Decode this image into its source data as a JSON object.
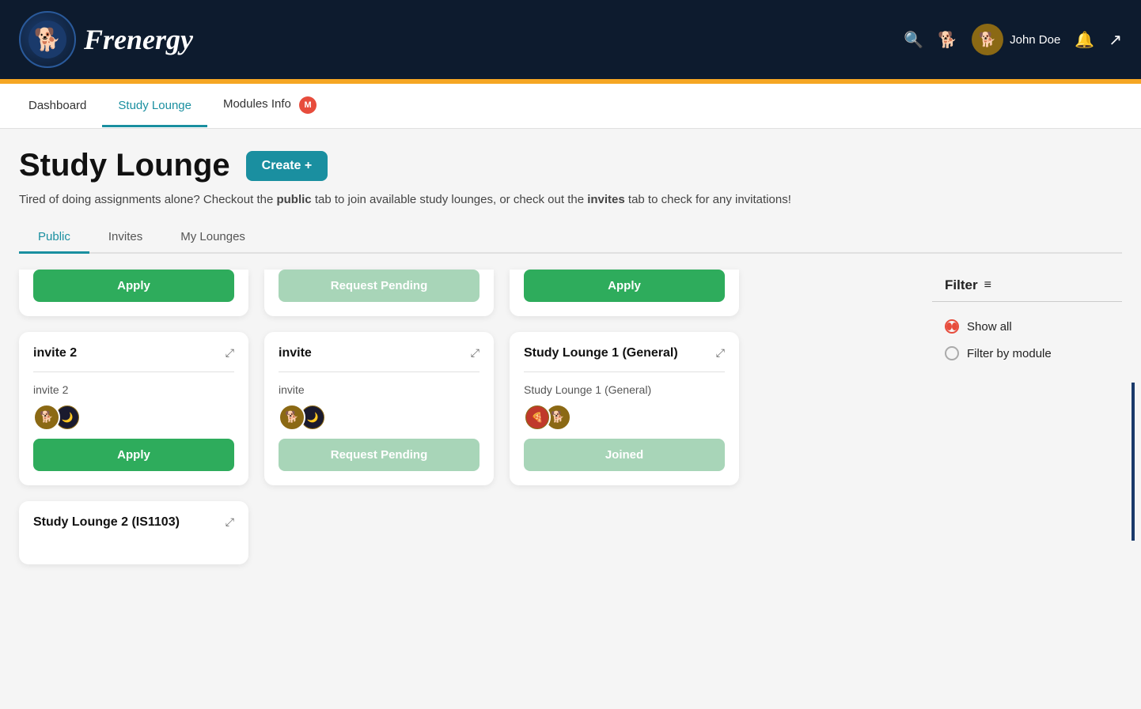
{
  "header": {
    "logo_text": "Frenergy",
    "user_name": "John Doe",
    "logo_emoji": "🐕"
  },
  "gold_bar": true,
  "nav": {
    "tabs": [
      {
        "label": "Dashboard",
        "active": false
      },
      {
        "label": "Study Lounge",
        "active": true
      },
      {
        "label": "Modules Info",
        "active": false,
        "badge": "M"
      }
    ]
  },
  "page": {
    "title": "Study Lounge",
    "create_label": "Create +",
    "description_prefix": "Tired of doing assignments alone? Checkout the ",
    "description_bold1": "public",
    "description_mid": " tab to join available study lounges, or check out the ",
    "description_bold2": "invites",
    "description_suffix": " tab to check for any invitations!"
  },
  "sub_tabs": [
    {
      "label": "Public",
      "active": true
    },
    {
      "label": "Invites",
      "active": false
    },
    {
      "label": "My Lounges",
      "active": false
    }
  ],
  "top_partial_cards": [
    {
      "button_type": "apply",
      "button_label": "Apply"
    },
    {
      "button_type": "pending",
      "button_label": "Request Pending"
    },
    {
      "button_type": "apply",
      "button_label": "Apply"
    }
  ],
  "cards_row1": [
    {
      "title": "invite 2",
      "description": "invite 2",
      "button_type": "apply",
      "button_label": "Apply",
      "avatars": [
        "🐕",
        "🌙"
      ]
    },
    {
      "title": "invite",
      "description": "invite",
      "button_type": "pending",
      "button_label": "Request Pending",
      "avatars": [
        "🐕",
        "🌙"
      ]
    },
    {
      "title": "Study Lounge 1 (General)",
      "description": "Study Lounge 1 (General)",
      "button_type": "joined",
      "button_label": "Joined",
      "avatars": [
        "🍕",
        "🐕"
      ]
    }
  ],
  "partial_card_bottom": {
    "title": "Study Lounge 2 (IS1103)",
    "visible": true
  },
  "filter": {
    "header": "Filter",
    "options": [
      {
        "label": "Show all",
        "selected": true
      },
      {
        "label": "Filter by module",
        "selected": false
      }
    ]
  },
  "icons": {
    "search": "🔍",
    "dog": "🐕",
    "bell": "🔔",
    "logout": "↗",
    "expand": "⤢",
    "filter_lines": "≡"
  }
}
